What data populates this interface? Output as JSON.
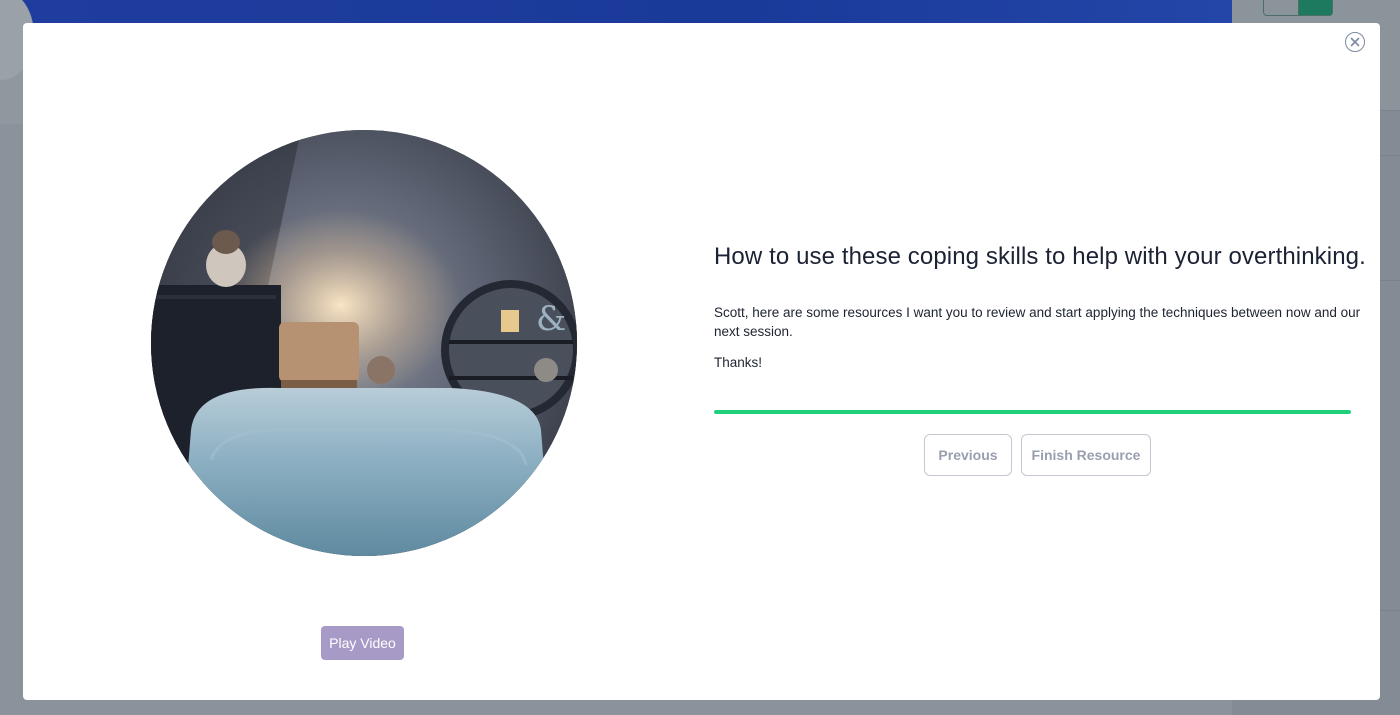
{
  "modal": {
    "title": "How to use these coping skills to help with your overthinking.",
    "message": "Scott, here are some resources I want you to review and start applying the techniques between now and our next session.",
    "thanks": "Thanks!",
    "progress": 1.0,
    "buttons": {
      "play_video": "Play Video",
      "previous": "Previous",
      "finish": "Finish Resource"
    },
    "icons": {
      "close": "close-icon",
      "video_thumbnail": "video-thumbnail"
    },
    "colors": {
      "progress": "#1fd07a",
      "play_button": "#a79ac7",
      "header": "#1f3d9e"
    }
  }
}
